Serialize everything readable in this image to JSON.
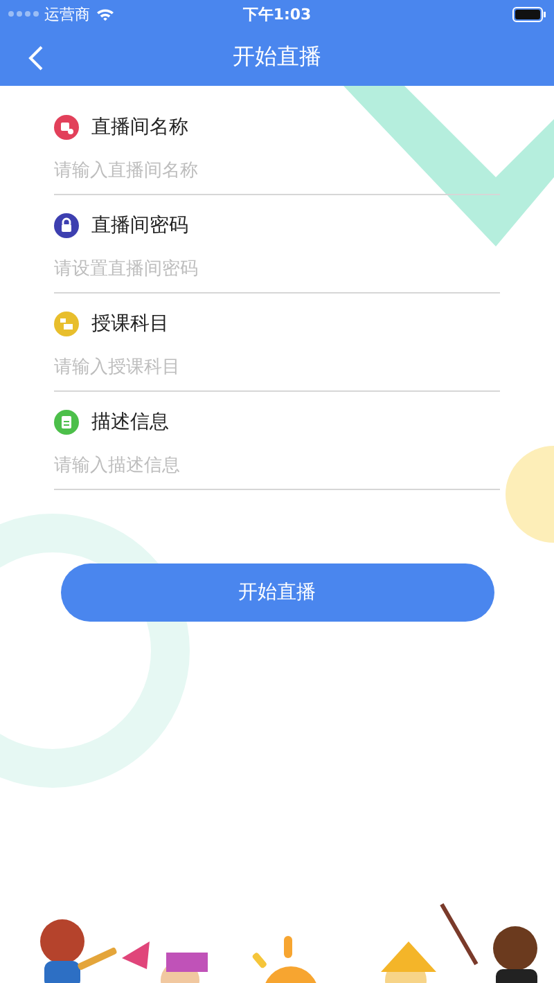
{
  "status_bar": {
    "carrier": "运营商",
    "time": "下午1:03"
  },
  "nav_bar": {
    "title": "开始直播"
  },
  "fields": [
    {
      "kind": "video",
      "color": "#e2405a",
      "label": "直播间名称",
      "placeholder": "请输入直播间名称"
    },
    {
      "kind": "lock",
      "color": "#3d3fb0",
      "label": "直播间密码",
      "placeholder": "请设置直播间密码"
    },
    {
      "kind": "list",
      "color": "#e8be2c",
      "label": "授课科目",
      "placeholder": "请输入授课科目"
    },
    {
      "kind": "document",
      "color": "#4cbf4a",
      "label": "描述信息",
      "placeholder": "请输入描述信息"
    }
  ],
  "submit_button": "开始直播"
}
